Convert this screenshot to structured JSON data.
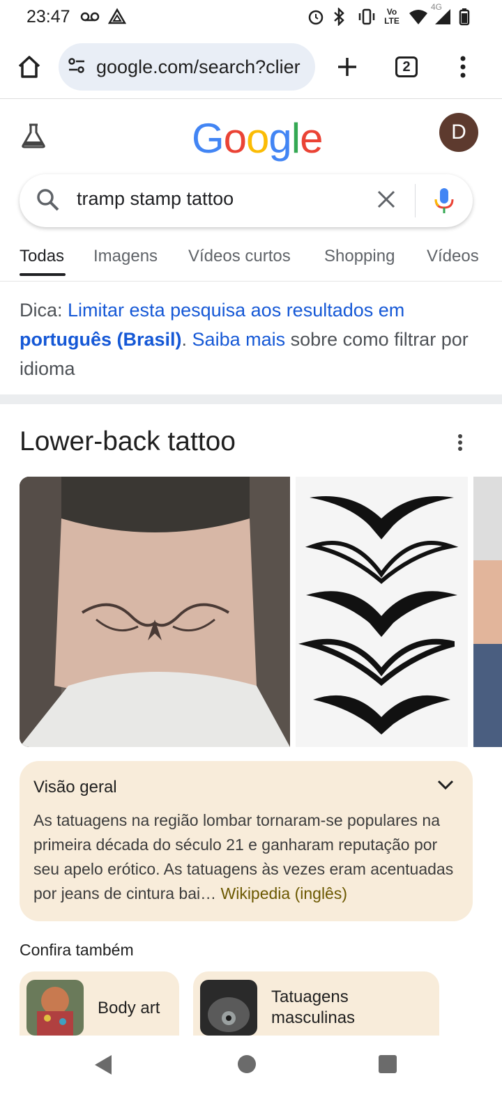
{
  "status_bar": {
    "time": "23:47",
    "lte_label": "Vo LTE",
    "net_label": "4G"
  },
  "browser": {
    "url": "google.com/search?clier",
    "tab_count": "2"
  },
  "google": {
    "logo_letters": [
      "G",
      "o",
      "o",
      "g",
      "l",
      "e"
    ],
    "logo_colors": [
      "#4285F4",
      "#EA4335",
      "#FBBC05",
      "#4285F4",
      "#34A853",
      "#EA4335"
    ],
    "avatar_letter": "D"
  },
  "search": {
    "query": "tramp stamp tattoo"
  },
  "tabs": [
    {
      "label": "Todas",
      "active": true
    },
    {
      "label": "Imagens"
    },
    {
      "label": "Vídeos curtos"
    },
    {
      "label": "Shopping"
    },
    {
      "label": "Vídeos"
    }
  ],
  "tip": {
    "prefix": "Dica: ",
    "link1": "Limitar esta pesquisa aos resultados em",
    "link1_bold": "português (Brasil)",
    "sep": ". ",
    "link2": "Saiba mais",
    "suffix": " sobre como filtrar por idioma"
  },
  "knowledge": {
    "title": "Lower-back tattoo",
    "overview_title": "Visão geral",
    "overview_text": "As tatuagens na região lombar tornaram-se populares na primeira década do século 21 e ganharam reputação por seu apelo erótico. As tatuagens às vezes eram acentuadas por jeans de cintura bai…",
    "overview_source": "Wikipedia (inglês)"
  },
  "see_also": {
    "heading": "Confira também",
    "items": [
      {
        "label": "Body art"
      },
      {
        "label": "Tatuagens masculinas"
      }
    ]
  }
}
